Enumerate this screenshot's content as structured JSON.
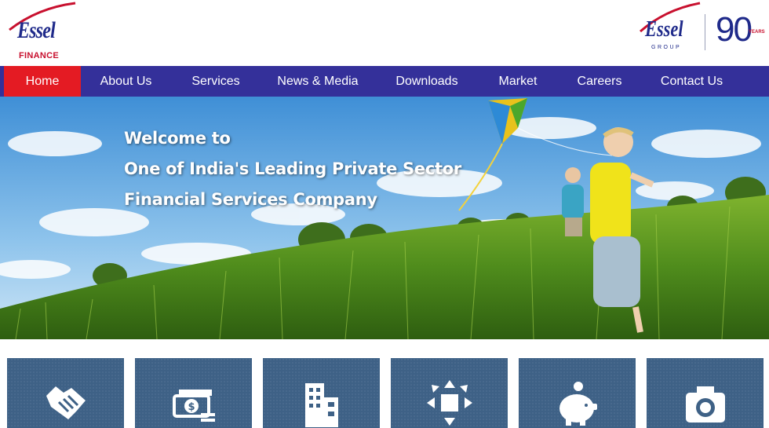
{
  "brand": {
    "left_logo_text": "Essel",
    "left_logo_sub": "FINANCE",
    "right_logo_text": "Essel",
    "right_logo_sub": "GROUP",
    "years_number": "90",
    "years_label": "YEARS"
  },
  "nav": {
    "items": [
      {
        "label": "Home",
        "active": true
      },
      {
        "label": "About Us",
        "active": false
      },
      {
        "label": "Services",
        "active": false
      },
      {
        "label": "News & Media",
        "active": false
      },
      {
        "label": "Downloads",
        "active": false
      },
      {
        "label": "Market",
        "active": false
      },
      {
        "label": "Careers",
        "active": false
      },
      {
        "label": "Contact Us",
        "active": false
      }
    ]
  },
  "hero": {
    "lines": [
      "Welcome to",
      "One of India's Leading Private Sector",
      "Financial Services Company"
    ]
  },
  "tiles": [
    {
      "icon": "handshake-icon"
    },
    {
      "icon": "money-icon"
    },
    {
      "icon": "building-icon"
    },
    {
      "icon": "expand-arrows-icon"
    },
    {
      "icon": "piggy-bank-icon"
    },
    {
      "icon": "camera-icon"
    }
  ],
  "colors": {
    "nav_bg": "#34309a",
    "nav_active": "#e41b23",
    "brand_blue": "#1f2a8a",
    "brand_red": "#c8102e",
    "tile_bg": "#3e6186"
  }
}
